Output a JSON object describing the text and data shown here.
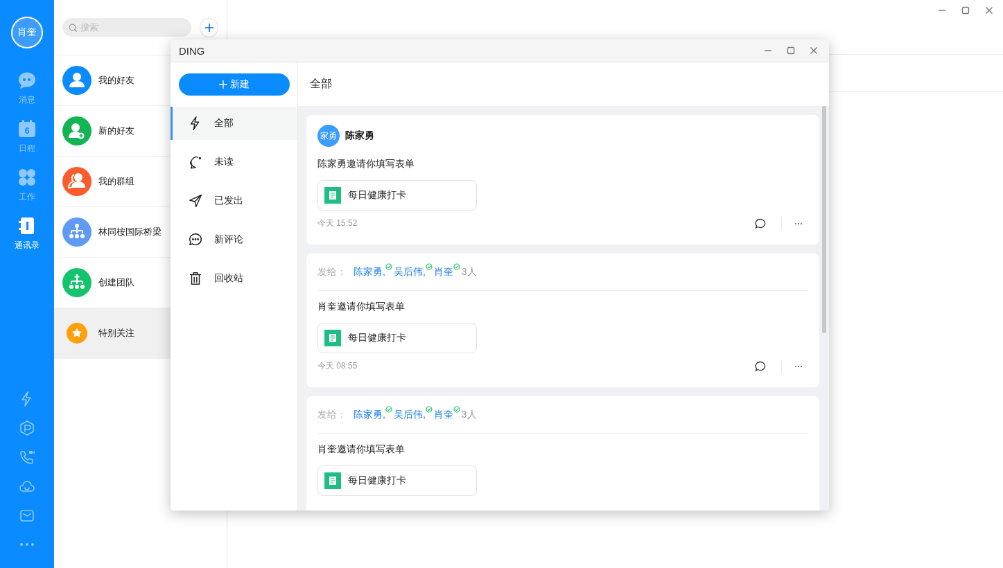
{
  "rail": {
    "avatar": "肖奎",
    "nav_items": [
      {
        "label": "消息",
        "kind": "chat",
        "selected": false
      },
      {
        "label": "日程",
        "kind": "calendar",
        "day": "6",
        "selected": false
      },
      {
        "label": "工作",
        "kind": "apps",
        "selected": false
      },
      {
        "label": "通讯录",
        "kind": "contacts",
        "selected": true
      }
    ]
  },
  "contacts": {
    "search": {
      "placeholder": "搜索"
    },
    "items": [
      {
        "label": "我的好友",
        "kind": "person",
        "color": "#0a8bff",
        "selected": false
      },
      {
        "label": "新的好友",
        "kind": "person-add",
        "color": "#13b454",
        "selected": false
      },
      {
        "label": "我的群组",
        "kind": "group",
        "color": "#fa5c2c",
        "selected": false
      },
      {
        "label": "林同桉国际桥梁",
        "kind": "org",
        "color": "#5f9bf5",
        "selected": false
      },
      {
        "label": "创建团队",
        "kind": "team-add",
        "color": "#13c46b",
        "selected": false
      },
      {
        "label": "特别关注",
        "kind": "star",
        "color": "#ff9f0a",
        "selected": true
      }
    ]
  },
  "dialog": {
    "title": "DING",
    "new_button": "新建",
    "nav": [
      {
        "label": "全部",
        "kind": "bolt",
        "selected": true
      },
      {
        "label": "未读",
        "kind": "unread",
        "selected": false
      },
      {
        "label": "已发出",
        "kind": "send",
        "selected": false
      },
      {
        "label": "新评论",
        "kind": "comment",
        "selected": false
      },
      {
        "label": "回收站",
        "kind": "trash",
        "selected": false
      }
    ],
    "header": "全部",
    "cards": [
      {
        "kind": "received",
        "avatar": "家勇",
        "sender": "陈家勇",
        "message": "陈家勇邀请你填写表单",
        "form": "每日健康打卡",
        "time": "今天 15:52"
      },
      {
        "kind": "sent",
        "to_label": "发给：",
        "recipients": [
          {
            "name": "陈家勇,",
            "read": true
          },
          {
            "name": "吴后伟,",
            "read": true
          },
          {
            "name": "肖奎",
            "read": true
          }
        ],
        "count": "3人",
        "message": "肖奎邀请你填写表单",
        "form": "每日健康打卡",
        "time": "今天 08:55"
      },
      {
        "kind": "sent",
        "to_label": "发给：",
        "recipients": [
          {
            "name": "陈家勇,",
            "read": true
          },
          {
            "name": "吴后伟,",
            "read": true
          },
          {
            "name": "肖奎",
            "read": true
          }
        ],
        "count": "3人",
        "message": "肖奎邀请你填写表单",
        "form": "每日健康打卡"
      }
    ]
  }
}
